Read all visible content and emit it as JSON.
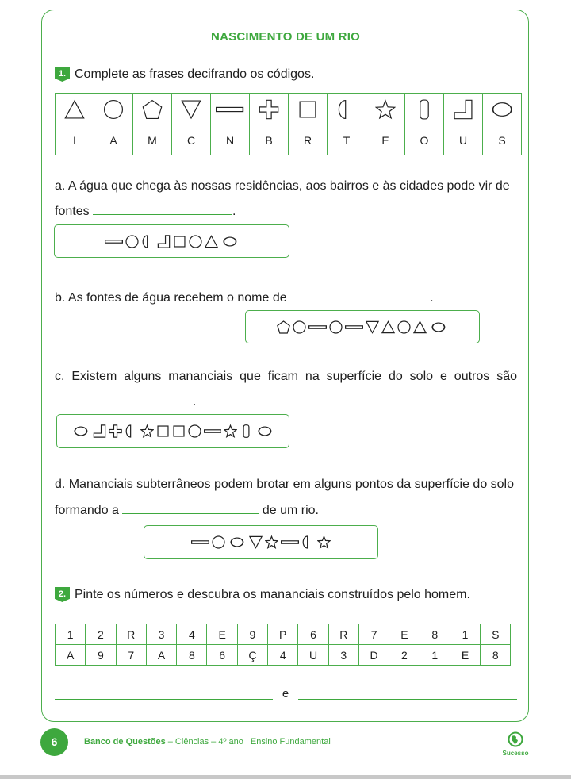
{
  "title": "NASCIMENTO DE UM RIO",
  "q1": {
    "number": "1.",
    "prompt": "Complete as frases decifrando os códigos.",
    "code_table": [
      {
        "symbol": "triangle-icon",
        "letter": "I"
      },
      {
        "symbol": "circle-icon",
        "letter": "A"
      },
      {
        "symbol": "pentagon-icon",
        "letter": "M"
      },
      {
        "symbol": "inverted-triangle-icon",
        "letter": "C"
      },
      {
        "symbol": "bar-icon",
        "letter": "N"
      },
      {
        "symbol": "plus-icon",
        "letter": "B"
      },
      {
        "symbol": "square-icon",
        "letter": "R"
      },
      {
        "symbol": "half-circle-icon",
        "letter": "T"
      },
      {
        "symbol": "star-icon",
        "letter": "E"
      },
      {
        "symbol": "capsule-icon",
        "letter": "O"
      },
      {
        "symbol": "L-shape-icon",
        "letter": "U"
      },
      {
        "symbol": "double-circle-icon",
        "letter": "S"
      }
    ],
    "items": {
      "a": {
        "line1": "a. A água que chega às nossas residências, aos bairros e às cidades pode vir de",
        "line2": "fontes",
        "line2_end": ".",
        "code": [
          "bar",
          "circle",
          "half",
          "L",
          "square",
          "circle",
          "triangle",
          "double"
        ]
      },
      "b": {
        "text": "b. As fontes de água recebem o nome de",
        "end": ".",
        "code": [
          "pentagon",
          "circle",
          "bar",
          "circle",
          "bar",
          "invtriangle",
          "triangle",
          "circle",
          "triangle",
          "double"
        ]
      },
      "c": {
        "line1": "c. Existem alguns mananciais que ficam na superfície do solo e outros são",
        "line2_end": ".",
        "code": [
          "double",
          "L",
          "plus",
          "half",
          "star",
          "square",
          "square",
          "circle",
          "bar",
          "star",
          "capsule",
          "double"
        ]
      },
      "d": {
        "line1": "d. Mananciais subterrâneos podem brotar em alguns pontos da superfície do solo",
        "line2_start": "formando a",
        "line2_end": "de um rio.",
        "code": [
          "bar",
          "circle",
          "double",
          "invtriangle",
          "star",
          "bar",
          "half",
          "star"
        ]
      }
    }
  },
  "q2": {
    "number": "2.",
    "prompt": "Pinte os números e descubra os mananciais construídos pelo homem.",
    "row1": [
      "1",
      "2",
      "R",
      "3",
      "4",
      "E",
      "9",
      "P",
      "6",
      "R",
      "7",
      "E",
      "8",
      "1",
      "S"
    ],
    "row2": [
      "A",
      "9",
      "7",
      "A",
      "8",
      "6",
      "Ç",
      "4",
      "U",
      "3",
      "D",
      "2",
      "1",
      "E",
      "8"
    ],
    "answer_separator": "e"
  },
  "footer": {
    "page_number": "6",
    "brand": "Banco de Questões",
    "subtitle": " – Ciências – 4º ano | Ensino Fundamental",
    "logo_label": "Sucesso",
    "accent_color": "#3ea83e"
  }
}
